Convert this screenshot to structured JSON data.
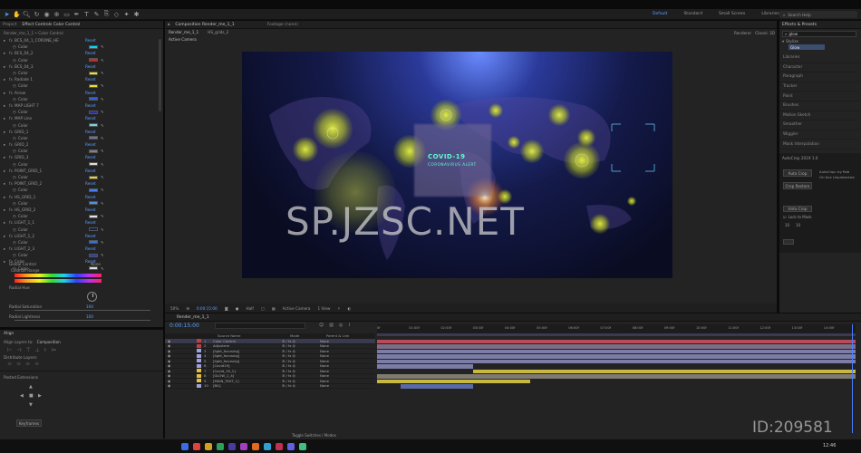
{
  "menu_bar": {
    "workspaces": [
      "Default",
      "Standard",
      "Small Screen",
      "Libraries"
    ],
    "search_label": "Search Help"
  },
  "left_panel": {
    "tabs": [
      "Project",
      "Effect Controls Color Control"
    ],
    "breadcrumb": "Render_me_1_1 • Color Control",
    "rows": [
      {
        "name": "BCS_04_1_CORONE_HE",
        "color": "#00d8ff"
      },
      {
        "name": "BCS_04_2",
        "color": "#e02020"
      },
      {
        "name": "BCS_04_3",
        "color": "#f0e020"
      },
      {
        "name": "Radiate 1",
        "color": "#e8e030"
      },
      {
        "name": "Arrow",
        "color": "#3060e0"
      },
      {
        "name": "MAP LIGHT 7",
        "color": "#2e2e8e"
      },
      {
        "name": "MAP Line",
        "color": "#7ad0e0"
      },
      {
        "name": "GRID_1",
        "color": "#7070a0"
      },
      {
        "name": "GRID_2",
        "color": "#808090"
      },
      {
        "name": "GRID_3",
        "color": "#dcdcdc"
      },
      {
        "name": "POINT_GRID_1",
        "color": "#e8d040"
      },
      {
        "name": "POINT_GRID_2",
        "color": "#4080ff"
      },
      {
        "name": "HS_GRID_1",
        "color": "#5090e0"
      },
      {
        "name": "HS_GRID_2",
        "color": "#e0e0e0"
      },
      {
        "name": "LIGHT_1_1",
        "color": "#102050"
      },
      {
        "name": "LIGHT_1_2",
        "color": "#3070f0"
      },
      {
        "name": "LIGHT_2_3",
        "color": "#2040c0"
      },
      {
        "name": "Color",
        "color": "#e0e0e0"
      }
    ],
    "reset_label": "Reset",
    "global_control_label": "Global Control",
    "global_value": "None",
    "colorize_label": "Colorize Range",
    "radial_hue_label": "Radial Hue",
    "radial_saturation_label": "Radial Saturation",
    "radial_saturation_value": "100",
    "radial_lightness_label": "Radial Lightness",
    "radial_lightness_value": "100"
  },
  "align_panel": {
    "title": "Align",
    "align_to_label": "Align Layers to:",
    "align_to_value": "Composition",
    "distribute_label": "Distribute Layers:",
    "script_title": "Pasted Extensions",
    "button_label": "Keyframes"
  },
  "composition": {
    "tabs": [
      "Composition Render_me_1_1",
      "Footage (none)"
    ],
    "sub_tabs": [
      "Render_me_1_1",
      "HS_grids_2"
    ],
    "active_camera": "Active Camera",
    "renderer_label": "Renderer",
    "renderer_value": "Classic 3D",
    "zoom": "50%",
    "timecode": "0:00:15:00",
    "quality": "Half",
    "camera_select": "Active Camera",
    "views": "1 View"
  },
  "viewer": {
    "title_line1": "COVID-19",
    "title_line2": "CORONAVIRUS ALERT"
  },
  "watermark": {
    "site": "SP.JZSC.NET",
    "id": "ID:209581"
  },
  "right_panel": {
    "tab": "Effects & Presets",
    "search_value": "glow",
    "folder": "Stylize",
    "result": "Glow",
    "categories": [
      "Libraries",
      "Character",
      "Paragraph",
      "Tracker",
      "Paint",
      "Brushes",
      "Motion Sketch",
      "Smoother",
      "Wiggler",
      "Mask Interpolation"
    ],
    "script_title": "AutoCrop 2019 1.0",
    "buttons": [
      "Auto Crop",
      "Crop Restore",
      "Unto Crop"
    ],
    "note_line1": "AutoCrop: by Rob",
    "note_line2": "Ori Ace Unprotected",
    "checkbox_label": "Lock to Mask",
    "field1": "10",
    "field2": "10"
  },
  "timeline": {
    "tabs": [
      "Render_me_1_1"
    ],
    "timecode": "0:00:15:00",
    "source_header": "Source Name",
    "mode_header": "Mode",
    "parent_header": "Parent & Link",
    "layers": [
      {
        "num": "1",
        "name": "Color Control",
        "color": "#c04040",
        "parent": "None",
        "selected": true
      },
      {
        "num": "2",
        "name": "Adjustme",
        "color": "#c04040",
        "parent": "None",
        "selected": false
      },
      {
        "num": "3",
        "name": "[light_focusing]",
        "color": "#a0a0e0",
        "parent": "None",
        "selected": false
      },
      {
        "num": "4",
        "name": "[light_focusing]",
        "color": "#a0a0e0",
        "parent": "None",
        "selected": false
      },
      {
        "num": "5",
        "name": "[light_focusing]",
        "color": "#a0a0e0",
        "parent": "None",
        "selected": false
      },
      {
        "num": "6",
        "name": "[Covid19]",
        "color": "#a0a0e0",
        "parent": "None",
        "selected": false
      },
      {
        "num": "7",
        "name": "[Covid_19_1]",
        "color": "#e0c040",
        "parent": "None",
        "selected": false
      },
      {
        "num": "8",
        "name": "[GLOW_1_4]",
        "color": "#e0c040",
        "parent": "None",
        "selected": false
      },
      {
        "num": "9",
        "name": "[MAIN_TEXT_1]",
        "color": "#e0c040",
        "parent": "None",
        "selected": false
      },
      {
        "num": "10",
        "name": "[BG]",
        "color": "#a0a0e0",
        "parent": "None",
        "selected": false
      }
    ],
    "ruler": [
      "0f",
      "01:00f",
      "02:00f",
      "03:00f",
      "04:00f",
      "05:00f",
      "06:00f",
      "07:00f",
      "08:00f",
      "09:00f",
      "10:00f",
      "11:00f",
      "12:00f",
      "13:00f",
      "14:00f"
    ],
    "toggle_label": "Toggle Switches / Modes"
  },
  "taskbar": {
    "clock": "12:46"
  }
}
